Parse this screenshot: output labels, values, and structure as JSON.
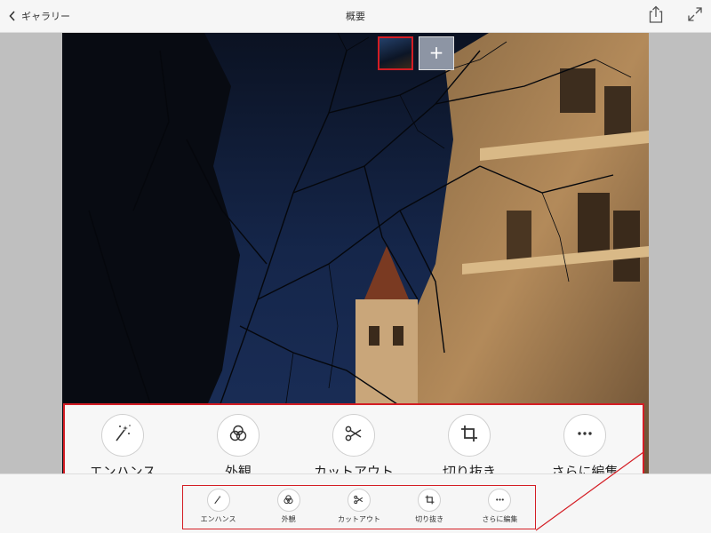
{
  "header": {
    "back_label": "ギャラリー",
    "title": "概要"
  },
  "tools": [
    {
      "label": "エンハンス",
      "icon": "magic-wand-icon"
    },
    {
      "label": "外観",
      "icon": "filters-icon"
    },
    {
      "label": "カットアウト",
      "icon": "scissors-icon"
    },
    {
      "label": "切り抜き",
      "icon": "crop-icon"
    },
    {
      "label": "さらに編集",
      "icon": "more-icon"
    }
  ],
  "thumbnails": {
    "add_label": "+"
  },
  "colors": {
    "highlight": "#d41d24",
    "toolbar_bg": "#f6f6f6",
    "canvas_bg": "#bfbfbf"
  }
}
